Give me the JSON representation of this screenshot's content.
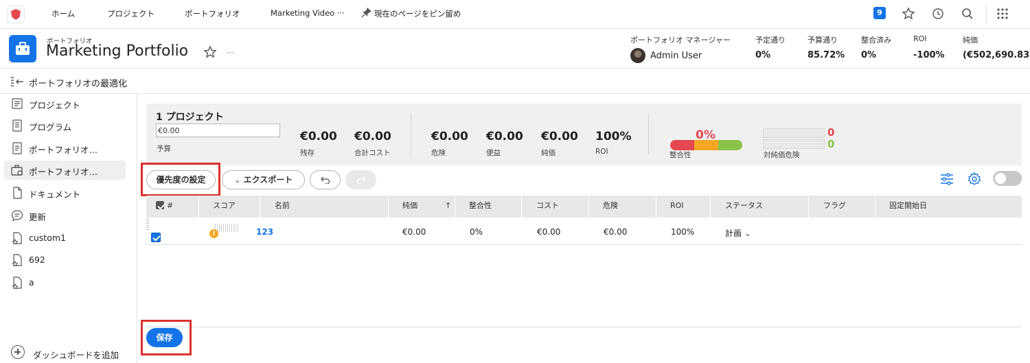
{
  "nav": {
    "home": "ホーム",
    "projects": "プロジェクト",
    "portfolio": "ポートフォリオ",
    "recent": "Marketing Video ···",
    "pin": "現在のページをピン留め",
    "notification_count": "9"
  },
  "header": {
    "subtitle": "ポートフォリオ",
    "title": "Marketing Portfolio",
    "more": "···",
    "manager_label": "ポートフォリオ マネージャー",
    "manager_name": "Admin User",
    "stats": [
      {
        "label": "予定通り",
        "value": "0%"
      },
      {
        "label": "予算通り",
        "value": "85.72%"
      },
      {
        "label": "整合済み",
        "value": "0%"
      },
      {
        "label": "ROI",
        "value": "-100%"
      },
      {
        "label": "純価",
        "value": "(€502,690.83)"
      }
    ]
  },
  "subheader": {
    "title": "ポートフォリオの最適化"
  },
  "sidebar": {
    "items": [
      {
        "label": "プロジェクト",
        "icon": "projects-icon"
      },
      {
        "label": "プログラム",
        "icon": "programs-icon"
      },
      {
        "label": "ポートフォリオ…",
        "icon": "portfolio-details-icon"
      },
      {
        "label": "ポートフォリオ…",
        "icon": "portfolio-optimizer-icon",
        "active": true
      },
      {
        "label": "ドキュメント",
        "icon": "document-icon"
      },
      {
        "label": "更新",
        "icon": "updates-icon"
      },
      {
        "label": "custom1",
        "icon": "custom-section-icon"
      },
      {
        "label": "692",
        "icon": "custom-section-icon"
      },
      {
        "label": "a",
        "icon": "custom-section-icon"
      }
    ],
    "add_dashboard": "ダッシュボードを追加"
  },
  "summary": {
    "count": "1 プロジェクト",
    "budget_value": "€0.00",
    "budget_label": "予算",
    "metrics": [
      {
        "value": "€0.00",
        "label": "残存"
      },
      {
        "value": "€0.00",
        "label": "合計コスト"
      },
      {
        "value": "€0.00",
        "label": "危険"
      },
      {
        "value": "€0.00",
        "label": "便益"
      },
      {
        "value": "€0.00",
        "label": "純価"
      },
      {
        "value": "100%",
        "label": "ROI"
      }
    ],
    "alignment_pct": "0%",
    "alignment_label": "整合性",
    "risk_top": "0",
    "risk_bottom": "0",
    "risk_label": "対純価危険",
    "colors": {
      "red": "#e34850",
      "orange": "#f5a623",
      "green": "#8bc34a"
    }
  },
  "toolbar": {
    "set_priority": "優先度の設定",
    "export": "エクスポート"
  },
  "table": {
    "headers": [
      "#",
      "スコア",
      "名前",
      "純価",
      "整合性",
      "コスト",
      "危険",
      "ROI",
      "ステータス",
      "フラグ",
      "固定開始日"
    ],
    "rows": [
      {
        "name": "123",
        "net_value": "€0.00",
        "alignment": "0%",
        "cost": "€0.00",
        "risk": "€0.00",
        "roi": "100%",
        "status": "計画"
      }
    ]
  },
  "footer": {
    "save": "保存"
  },
  "accent_color": "#1473e6",
  "highlight_color": "#d9332b"
}
